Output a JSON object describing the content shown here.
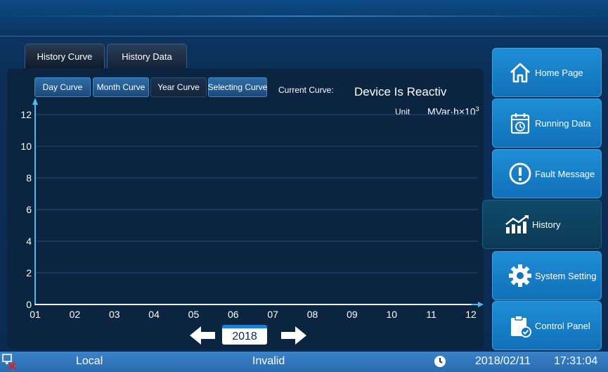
{
  "tabs": [
    {
      "label": "History Curve"
    },
    {
      "label": "History Data"
    }
  ],
  "curve_buttons": [
    {
      "label": "Day Curve"
    },
    {
      "label": "Month Curve"
    },
    {
      "label": "Year Curve"
    },
    {
      "label": "Selecting Curve"
    }
  ],
  "current_curve_label": "Current Curve:",
  "current_curve_value": "Device Is Reactiv",
  "unit_label": "Unit",
  "unit_value": "MVar·h×10",
  "unit_exponent": "3",
  "year": "2018",
  "sidebar": [
    {
      "label": "Home Page",
      "icon": "home-icon"
    },
    {
      "label": "Running Data",
      "icon": "calendar-clock-icon"
    },
    {
      "label": "Fault Message",
      "icon": "exclamation-circle-icon"
    },
    {
      "label": "History",
      "icon": "trend-chart-icon"
    },
    {
      "label": "System Setting",
      "icon": "gear-icon"
    },
    {
      "label": "Control Panel",
      "icon": "clipboard-check-icon"
    }
  ],
  "status": {
    "mode": "Local",
    "state": "Invalid",
    "date": "2018/02/11",
    "time": "17:31:04"
  },
  "colors": {
    "accent": "#1f8ed6",
    "axis": "#4fb8f0",
    "status_bar": "#3a82c8"
  },
  "chart_data": {
    "type": "line",
    "x": [
      "01",
      "02",
      "03",
      "04",
      "05",
      "06",
      "07",
      "08",
      "09",
      "10",
      "11",
      "12"
    ],
    "series": [
      {
        "values": [
          0,
          0,
          0,
          0,
          0,
          0,
          0,
          0,
          0,
          0,
          0,
          0
        ]
      }
    ],
    "ylim": [
      0,
      12
    ],
    "yticks": [
      0,
      2,
      4,
      6,
      8,
      10,
      12
    ],
    "grid": true
  }
}
